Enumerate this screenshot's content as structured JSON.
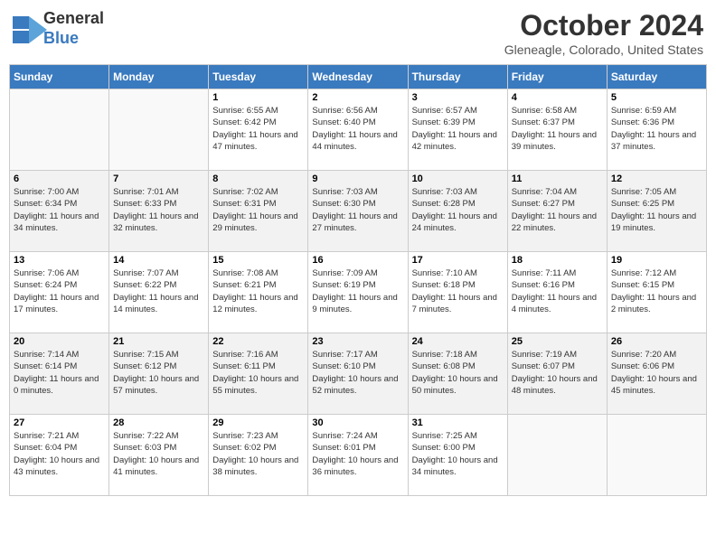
{
  "header": {
    "logo_line1": "General",
    "logo_line2": "Blue",
    "main_title": "October 2024",
    "subtitle": "Gleneagle, Colorado, United States"
  },
  "days_of_week": [
    "Sunday",
    "Monday",
    "Tuesday",
    "Wednesday",
    "Thursday",
    "Friday",
    "Saturday"
  ],
  "weeks": [
    [
      {
        "day": "",
        "info": ""
      },
      {
        "day": "",
        "info": ""
      },
      {
        "day": "1",
        "info": "Sunrise: 6:55 AM\nSunset: 6:42 PM\nDaylight: 11 hours and 47 minutes."
      },
      {
        "day": "2",
        "info": "Sunrise: 6:56 AM\nSunset: 6:40 PM\nDaylight: 11 hours and 44 minutes."
      },
      {
        "day": "3",
        "info": "Sunrise: 6:57 AM\nSunset: 6:39 PM\nDaylight: 11 hours and 42 minutes."
      },
      {
        "day": "4",
        "info": "Sunrise: 6:58 AM\nSunset: 6:37 PM\nDaylight: 11 hours and 39 minutes."
      },
      {
        "day": "5",
        "info": "Sunrise: 6:59 AM\nSunset: 6:36 PM\nDaylight: 11 hours and 37 minutes."
      }
    ],
    [
      {
        "day": "6",
        "info": "Sunrise: 7:00 AM\nSunset: 6:34 PM\nDaylight: 11 hours and 34 minutes."
      },
      {
        "day": "7",
        "info": "Sunrise: 7:01 AM\nSunset: 6:33 PM\nDaylight: 11 hours and 32 minutes."
      },
      {
        "day": "8",
        "info": "Sunrise: 7:02 AM\nSunset: 6:31 PM\nDaylight: 11 hours and 29 minutes."
      },
      {
        "day": "9",
        "info": "Sunrise: 7:03 AM\nSunset: 6:30 PM\nDaylight: 11 hours and 27 minutes."
      },
      {
        "day": "10",
        "info": "Sunrise: 7:03 AM\nSunset: 6:28 PM\nDaylight: 11 hours and 24 minutes."
      },
      {
        "day": "11",
        "info": "Sunrise: 7:04 AM\nSunset: 6:27 PM\nDaylight: 11 hours and 22 minutes."
      },
      {
        "day": "12",
        "info": "Sunrise: 7:05 AM\nSunset: 6:25 PM\nDaylight: 11 hours and 19 minutes."
      }
    ],
    [
      {
        "day": "13",
        "info": "Sunrise: 7:06 AM\nSunset: 6:24 PM\nDaylight: 11 hours and 17 minutes."
      },
      {
        "day": "14",
        "info": "Sunrise: 7:07 AM\nSunset: 6:22 PM\nDaylight: 11 hours and 14 minutes."
      },
      {
        "day": "15",
        "info": "Sunrise: 7:08 AM\nSunset: 6:21 PM\nDaylight: 11 hours and 12 minutes."
      },
      {
        "day": "16",
        "info": "Sunrise: 7:09 AM\nSunset: 6:19 PM\nDaylight: 11 hours and 9 minutes."
      },
      {
        "day": "17",
        "info": "Sunrise: 7:10 AM\nSunset: 6:18 PM\nDaylight: 11 hours and 7 minutes."
      },
      {
        "day": "18",
        "info": "Sunrise: 7:11 AM\nSunset: 6:16 PM\nDaylight: 11 hours and 4 minutes."
      },
      {
        "day": "19",
        "info": "Sunrise: 7:12 AM\nSunset: 6:15 PM\nDaylight: 11 hours and 2 minutes."
      }
    ],
    [
      {
        "day": "20",
        "info": "Sunrise: 7:14 AM\nSunset: 6:14 PM\nDaylight: 11 hours and 0 minutes."
      },
      {
        "day": "21",
        "info": "Sunrise: 7:15 AM\nSunset: 6:12 PM\nDaylight: 10 hours and 57 minutes."
      },
      {
        "day": "22",
        "info": "Sunrise: 7:16 AM\nSunset: 6:11 PM\nDaylight: 10 hours and 55 minutes."
      },
      {
        "day": "23",
        "info": "Sunrise: 7:17 AM\nSunset: 6:10 PM\nDaylight: 10 hours and 52 minutes."
      },
      {
        "day": "24",
        "info": "Sunrise: 7:18 AM\nSunset: 6:08 PM\nDaylight: 10 hours and 50 minutes."
      },
      {
        "day": "25",
        "info": "Sunrise: 7:19 AM\nSunset: 6:07 PM\nDaylight: 10 hours and 48 minutes."
      },
      {
        "day": "26",
        "info": "Sunrise: 7:20 AM\nSunset: 6:06 PM\nDaylight: 10 hours and 45 minutes."
      }
    ],
    [
      {
        "day": "27",
        "info": "Sunrise: 7:21 AM\nSunset: 6:04 PM\nDaylight: 10 hours and 43 minutes."
      },
      {
        "day": "28",
        "info": "Sunrise: 7:22 AM\nSunset: 6:03 PM\nDaylight: 10 hours and 41 minutes."
      },
      {
        "day": "29",
        "info": "Sunrise: 7:23 AM\nSunset: 6:02 PM\nDaylight: 10 hours and 38 minutes."
      },
      {
        "day": "30",
        "info": "Sunrise: 7:24 AM\nSunset: 6:01 PM\nDaylight: 10 hours and 36 minutes."
      },
      {
        "day": "31",
        "info": "Sunrise: 7:25 AM\nSunset: 6:00 PM\nDaylight: 10 hours and 34 minutes."
      },
      {
        "day": "",
        "info": ""
      },
      {
        "day": "",
        "info": ""
      }
    ]
  ]
}
